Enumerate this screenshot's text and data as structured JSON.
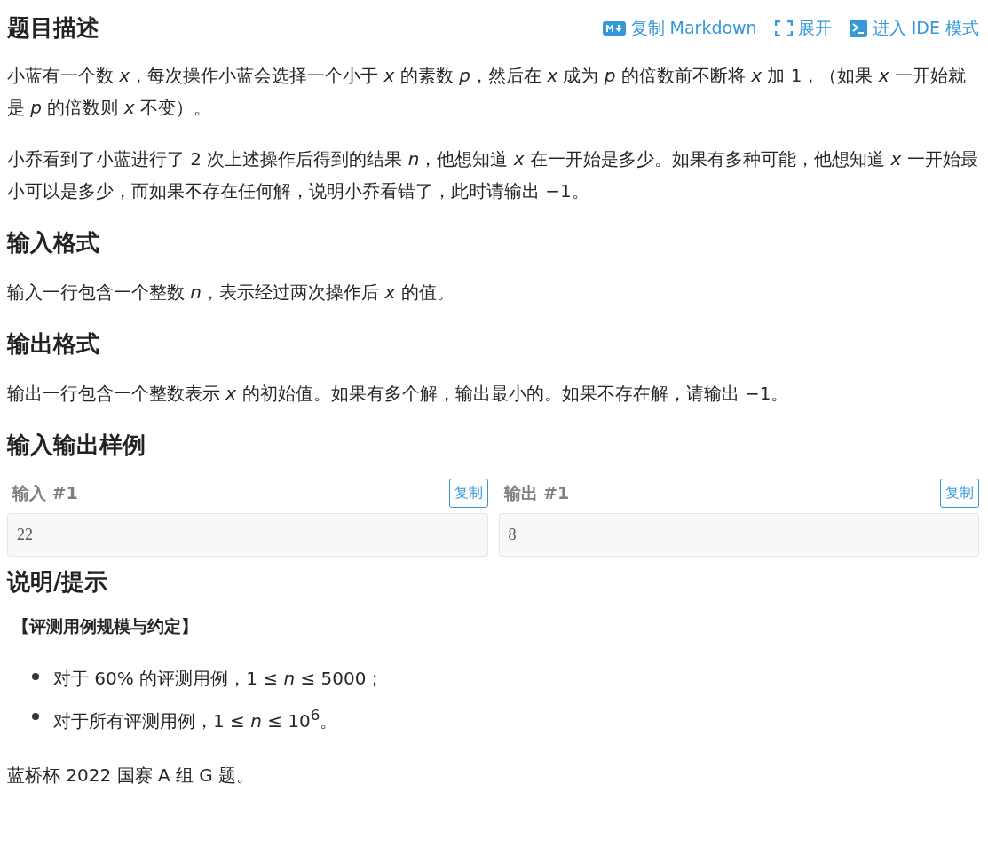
{
  "header": {
    "title": "题目描述",
    "actions": [
      {
        "kind": "markdown",
        "label": "复制 Markdown"
      },
      {
        "kind": "expand",
        "label": "展开"
      },
      {
        "kind": "ide",
        "label": "进入 IDE 模式"
      }
    ]
  },
  "blocks": [
    {
      "kind": "paragraph",
      "text": "小蓝有一个数 *x*，每次操作小蓝会选择一个小于 *x* 的素数 *p*，然后在 *x* 成为 *p* 的倍数前不断将 *x* 加 1，（如果 *x* 一开始就是 *p* 的倍数则 *x* 不变）。"
    },
    {
      "kind": "paragraph",
      "text": "小乔看到了小蓝进行了 2 次上述操作后得到的结果 *n*，他想知道 *x* 在一开始是多少。如果有多种可能，他想知道 *x* 一开始最小可以是多少，而如果不存在任何解，说明小乔看错了，此时请输出 −1。"
    },
    {
      "kind": "heading",
      "text": "输入格式"
    },
    {
      "kind": "paragraph",
      "text": "输入一行包含一个整数 *n*，表示经过两次操作后 *x* 的值。"
    },
    {
      "kind": "heading",
      "text": "输出格式"
    },
    {
      "kind": "paragraph",
      "text": "输出一行包含一个整数表示 *x* 的初始值。如果有多个解，输出最小的。如果不存在解，请输出 −1。"
    },
    {
      "kind": "heading",
      "text": "输入输出样例"
    },
    {
      "kind": "samples",
      "items": [
        {
          "label": "输入 #1",
          "button": "复制",
          "value": "22"
        },
        {
          "label": "输出 #1",
          "button": "复制",
          "value": "8"
        }
      ]
    },
    {
      "kind": "heading",
      "text": "说明/提示"
    },
    {
      "kind": "subheading",
      "text": "【评测用例规模与约定】"
    },
    {
      "kind": "list",
      "items": [
        "对于 60% 的评测用例，1 ≤ *n* ≤ 5000；",
        "对于所有评测用例，1 ≤ *n* ≤ 10$^{6}$。"
      ]
    },
    {
      "kind": "paragraph",
      "text": "蓝桥杯 2022 国赛 A 组 G 题。"
    }
  ]
}
